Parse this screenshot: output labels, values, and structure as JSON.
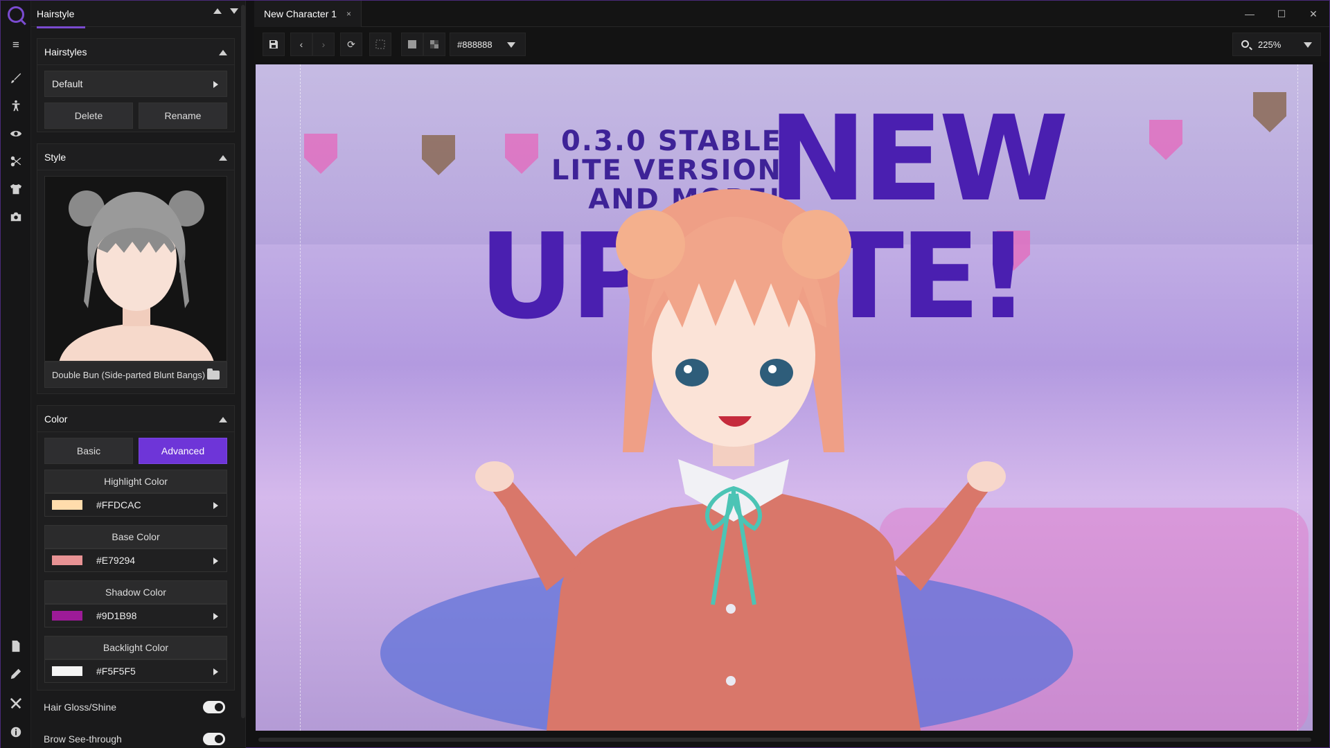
{
  "rail": {
    "icons": [
      "menu-icon",
      "brush-icon",
      "body-icon",
      "eye-icon",
      "scissors-icon",
      "shirt-icon",
      "camera-icon",
      "document-icon",
      "pencil-icon",
      "tools-icon",
      "info-icon"
    ]
  },
  "panel": {
    "title": "Hairstyle",
    "hairstyles": {
      "heading": "Hairstyles",
      "selected": "Default",
      "delete_label": "Delete",
      "rename_label": "Rename"
    },
    "style": {
      "heading": "Style",
      "current_name": "Double Bun (Side-parted Blunt Bangs)"
    },
    "color": {
      "heading": "Color",
      "mode_basic": "Basic",
      "mode_advanced": "Advanced",
      "entries": [
        {
          "label": "Highlight Color",
          "value": "#FFDCAC"
        },
        {
          "label": "Base Color",
          "value": "#E79294"
        },
        {
          "label": "Shadow Color",
          "value": "#9D1B98"
        },
        {
          "label": "Backlight Color",
          "value": "#F5F5F5"
        }
      ]
    },
    "toggles": [
      {
        "label": "Hair Gloss/Shine",
        "on": true
      },
      {
        "label": "Brow See-through",
        "on": true
      }
    ]
  },
  "tab": {
    "title": "New Character 1",
    "close": "×"
  },
  "window": {
    "minimize": "—",
    "maximize": "☐",
    "close": "✕"
  },
  "toolbar": {
    "bg_color": "#888888",
    "zoom": "225%"
  },
  "canvas": {
    "line1": "0.3.0 STABLE",
    "line2": "LITE VERSION",
    "line3": "AND MORE!",
    "big1": "NEW",
    "big2": "UPDATE!"
  },
  "colors": {
    "accent": "#6E35D8"
  }
}
